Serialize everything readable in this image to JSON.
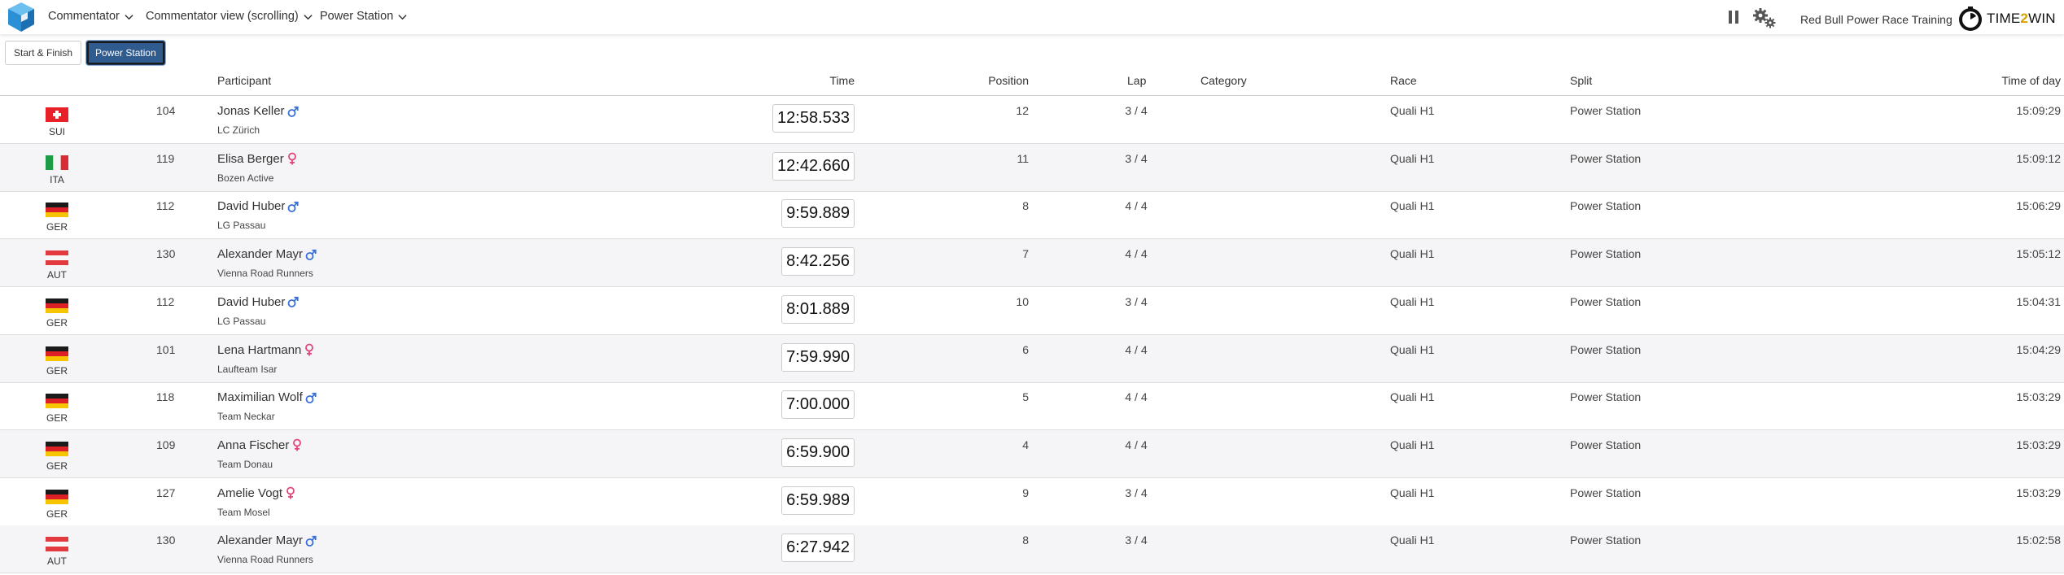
{
  "header": {
    "menus": [
      {
        "label": "Commentator"
      },
      {
        "label": "Commentator view (scrolling)"
      },
      {
        "label": "Power Station"
      }
    ],
    "event_title": "Red Bull Power Race Training",
    "brand": {
      "prefix": "TIME",
      "accent": "2",
      "suffix": "WIN"
    }
  },
  "tabs": [
    {
      "label": "Start & Finish",
      "active": false
    },
    {
      "label": "Power Station",
      "active": true
    }
  ],
  "columns": {
    "participant": "Participant",
    "time": "Time",
    "position": "Position",
    "lap": "Lap",
    "category": "Category",
    "race": "Race",
    "split": "Split",
    "time_of_day": "Time of day"
  },
  "rows": [
    {
      "nation": "SUI",
      "bib": "104",
      "name": "Jonas Keller",
      "gender": "male",
      "club": "LC Zürich",
      "time": "12:58.533",
      "position": "12",
      "lap": "3 / 4",
      "category": "",
      "race": "Quali H1",
      "split": "Power Station",
      "time_of_day": "15:09:29"
    },
    {
      "nation": "ITA",
      "bib": "119",
      "name": "Elisa Berger",
      "gender": "female",
      "club": "Bozen Active",
      "time": "12:42.660",
      "position": "11",
      "lap": "3 / 4",
      "category": "",
      "race": "Quali H1",
      "split": "Power Station",
      "time_of_day": "15:09:12"
    },
    {
      "nation": "GER",
      "bib": "112",
      "name": "David Huber",
      "gender": "male",
      "club": "LG Passau",
      "time": "9:59.889",
      "position": "8",
      "lap": "4 / 4",
      "category": "",
      "race": "Quali H1",
      "split": "Power Station",
      "time_of_day": "15:06:29"
    },
    {
      "nation": "AUT",
      "bib": "130",
      "name": "Alexander Mayr",
      "gender": "male",
      "club": "Vienna Road Runners",
      "time": "8:42.256",
      "position": "7",
      "lap": "4 / 4",
      "category": "",
      "race": "Quali H1",
      "split": "Power Station",
      "time_of_day": "15:05:12"
    },
    {
      "nation": "GER",
      "bib": "112",
      "name": "David Huber",
      "gender": "male",
      "club": "LG Passau",
      "time": "8:01.889",
      "position": "10",
      "lap": "3 / 4",
      "category": "",
      "race": "Quali H1",
      "split": "Power Station",
      "time_of_day": "15:04:31"
    },
    {
      "nation": "GER",
      "bib": "101",
      "name": "Lena Hartmann",
      "gender": "female",
      "club": "Laufteam Isar",
      "time": "7:59.990",
      "position": "6",
      "lap": "4 / 4",
      "category": "",
      "race": "Quali H1",
      "split": "Power Station",
      "time_of_day": "15:04:29"
    },
    {
      "nation": "GER",
      "bib": "118",
      "name": "Maximilian Wolf",
      "gender": "male",
      "club": "Team Neckar",
      "time": "7:00.000",
      "position": "5",
      "lap": "4 / 4",
      "category": "",
      "race": "Quali H1",
      "split": "Power Station",
      "time_of_day": "15:03:29"
    },
    {
      "nation": "GER",
      "bib": "109",
      "name": "Anna Fischer",
      "gender": "female",
      "club": "Team Donau",
      "time": "6:59.900",
      "position": "4",
      "lap": "4 / 4",
      "category": "",
      "race": "Quali H1",
      "split": "Power Station",
      "time_of_day": "15:03:29"
    },
    {
      "nation": "GER",
      "bib": "127",
      "name": "Amelie Vogt",
      "gender": "female",
      "club": "Team Mosel",
      "time": "6:59.989",
      "position": "9",
      "lap": "3 / 4",
      "category": "",
      "race": "Quali H1",
      "split": "Power Station",
      "time_of_day": "15:03:29"
    },
    {
      "nation": "AUT",
      "bib": "130",
      "name": "Alexander Mayr",
      "gender": "male",
      "club": "Vienna Road Runners",
      "time": "6:27.942",
      "position": "8",
      "lap": "3 / 4",
      "category": "",
      "race": "Quali H1",
      "split": "Power Station",
      "time_of_day": "15:02:58"
    }
  ],
  "colors": {
    "male_symbol": "#3a6fd8",
    "female_symbol": "#e0457b",
    "active_tab": "#2f5b8f",
    "logo_blue": "#3a9ad9",
    "brand_accent": "#d6a100"
  },
  "icons": {
    "app_logo": "cube-logo-icon",
    "menu_chevron": "chevron-down-icon",
    "pause": "pause-icon",
    "settings": "gears-icon",
    "brand": "stopwatch-icon"
  }
}
